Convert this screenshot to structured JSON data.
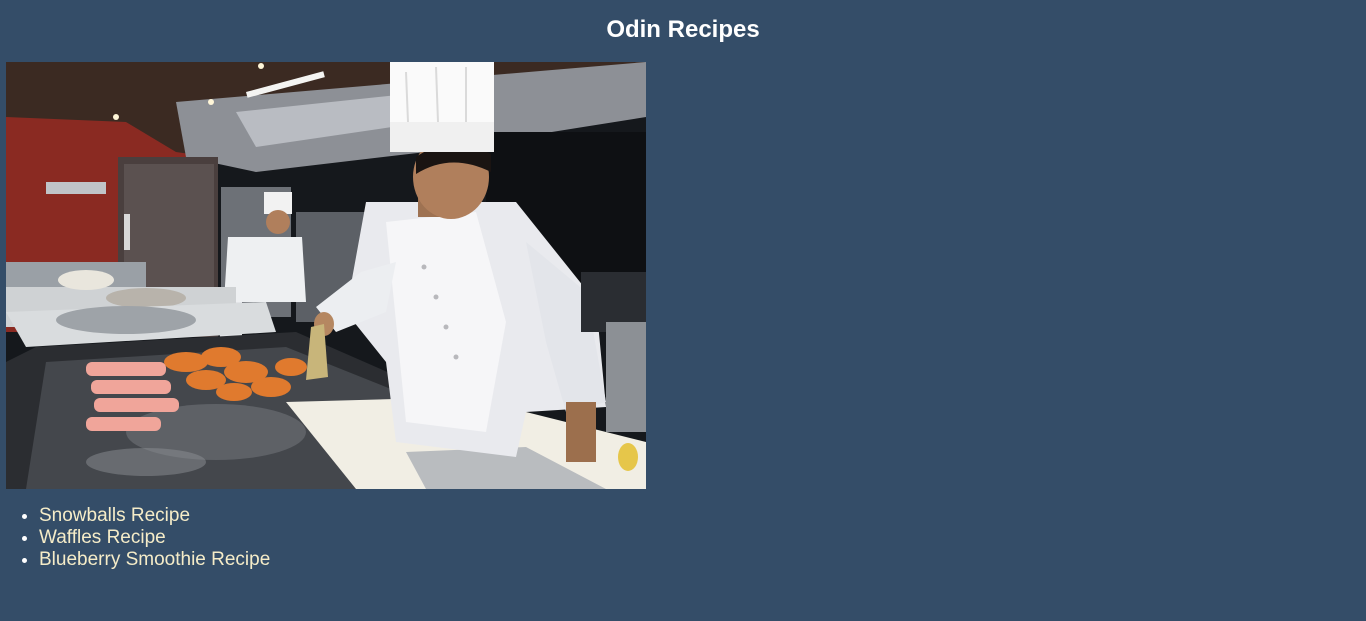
{
  "page": {
    "title": "Odin Recipes"
  },
  "hero_image": {
    "alt": "Chef cooking skewers and wings on a flat-top grill in a restaurant kitchen"
  },
  "recipes": [
    {
      "label": "Snowballs Recipe"
    },
    {
      "label": "Waffles Recipe"
    },
    {
      "label": "Blueberry Smoothie Recipe"
    }
  ],
  "colors": {
    "background": "#344d68",
    "title": "#ffffff",
    "link": "#f5ecc8"
  }
}
